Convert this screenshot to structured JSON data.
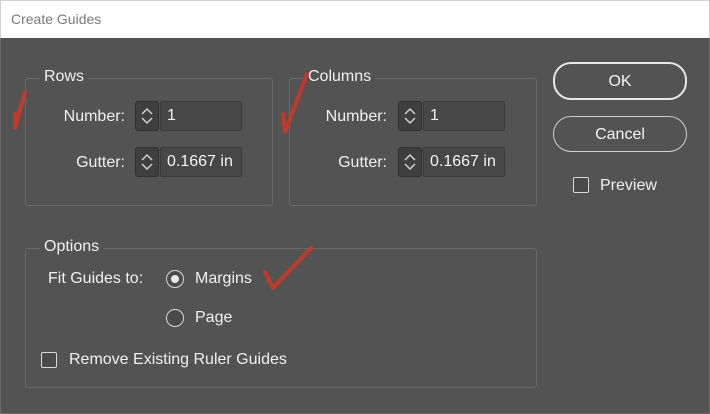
{
  "window": {
    "title": "Create Guides"
  },
  "rows": {
    "legend": "Rows",
    "number_label": "Number:",
    "number_value": "1",
    "gutter_label": "Gutter:",
    "gutter_value": "0.1667 in"
  },
  "columns": {
    "legend": "Columns",
    "number_label": "Number:",
    "number_value": "1",
    "gutter_label": "Gutter:",
    "gutter_value": "0.1667 in"
  },
  "options": {
    "legend": "Options",
    "fit_label": "Fit Guides to:",
    "radio_margins": {
      "label": "Margins",
      "selected": true
    },
    "radio_page": {
      "label": "Page",
      "selected": false
    },
    "remove_existing": {
      "label": "Remove Existing Ruler Guides",
      "checked": false
    }
  },
  "buttons": {
    "ok": "OK",
    "cancel": "Cancel"
  },
  "preview": {
    "label": "Preview",
    "checked": false
  },
  "colors": {
    "dialog_bg": "#535353",
    "annotation_red": "#c0392b"
  }
}
